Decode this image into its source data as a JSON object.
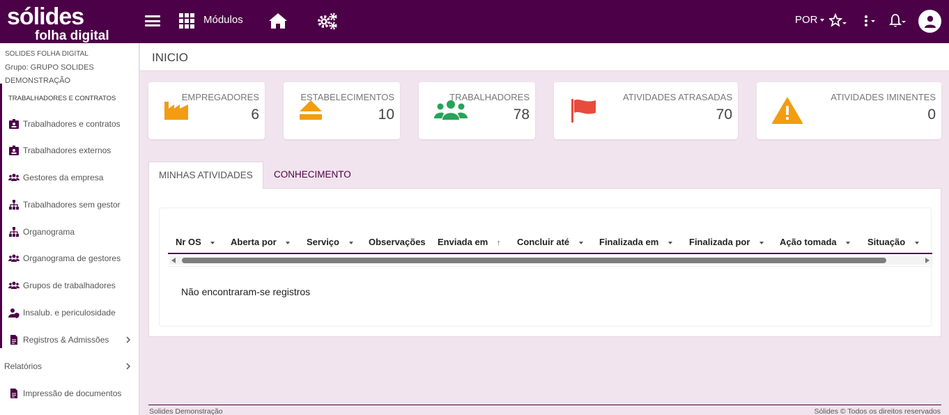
{
  "brand": {
    "logo_main": "sólides",
    "logo_sub": "folha digital"
  },
  "topbar": {
    "modules_label": "Módulos",
    "language": "POR",
    "icons": [
      "hamburger-icon",
      "grid-icon",
      "home-icon",
      "gears-icon",
      "star-icon",
      "dots-icon",
      "bell-icon",
      "user-icon"
    ]
  },
  "sidebar": {
    "company": "SOLIDES FOLHA DIGITAL",
    "group": "Grupo: GRUPO SOLIDES DEMONSTRAÇÃO",
    "section": "TRABALHADORES E CONTRATOS",
    "items": [
      {
        "label": "Trabalhadores e contratos",
        "icon": "id-badge-icon"
      },
      {
        "label": "Trabalhadores externos",
        "icon": "id-badge-icon"
      },
      {
        "label": "Gestores da empresa",
        "icon": "users-icon"
      },
      {
        "label": "Trabalhadores sem gestor",
        "icon": "sitemap-icon"
      },
      {
        "label": "Organograma",
        "icon": "sitemap-icon"
      },
      {
        "label": "Organograma de gestores",
        "icon": "users-icon"
      },
      {
        "label": "Grupos de trabalhadores",
        "icon": "users-icon"
      },
      {
        "label": "Insalub. e periculosidade",
        "icon": "user-shield-icon"
      },
      {
        "label": "Registros & Admissões",
        "icon": "file-icon"
      }
    ],
    "reports_label": "Relatórios",
    "print_label": "Impressão de documentos"
  },
  "page": {
    "title": "INICIO"
  },
  "cards": [
    {
      "label": "EMPREGADORES",
      "value": "6",
      "icon": "factory-icon",
      "color": "#f39c12"
    },
    {
      "label": "ESTABELECIMENTOS",
      "value": "10",
      "icon": "eject-icon",
      "color": "#f39c12"
    },
    {
      "label": "TRABALHADORES",
      "value": "78",
      "icon": "users-icon",
      "color": "#27a35a"
    },
    {
      "label": "ATIVIDADES ATRASADAS",
      "value": "70",
      "icon": "flag-icon",
      "color": "#e74c3c"
    },
    {
      "label": "ATIVIDADES IMINENTES",
      "value": "0",
      "icon": "warning-icon",
      "color": "#f39c12"
    }
  ],
  "tabs": [
    {
      "label": "MINHAS ATIVIDADES",
      "active": true
    },
    {
      "label": "CONHECIMENTO",
      "active": false
    }
  ],
  "table": {
    "columns": [
      "Nr OS",
      "Aberta por",
      "Serviço",
      "Observações",
      "Enviada em",
      "Concluir até",
      "Finalizada em",
      "Finalizada por",
      "Ação tomada",
      "Situação"
    ],
    "empty_message": "Não encontraram-se registros"
  },
  "footer": {
    "left": "Solides Demonstração",
    "right": "Sólides © Todos os direitos reservados"
  },
  "colors": {
    "brand": "#4c0047",
    "background": "#f1e4ee"
  }
}
